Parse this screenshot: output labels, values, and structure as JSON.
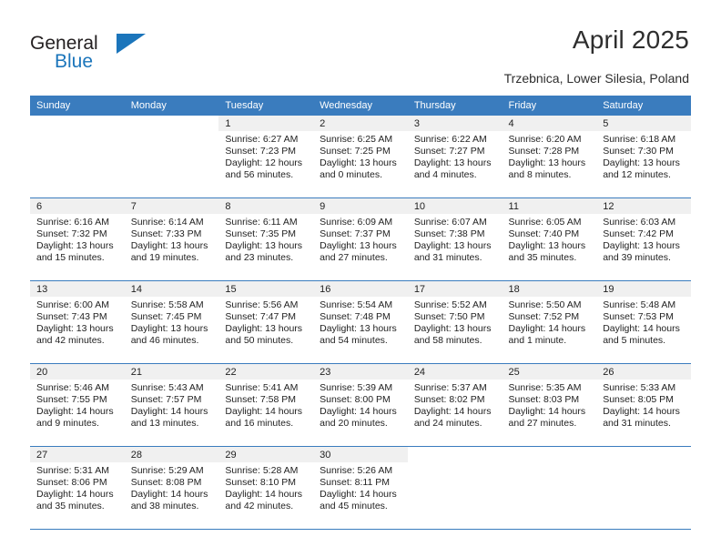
{
  "brand": {
    "name_part1": "General",
    "name_part2": "Blue",
    "logo_icon": "blue-triangle-icon"
  },
  "header": {
    "title": "April 2025",
    "subtitle": "Trzebnica, Lower Silesia, Poland"
  },
  "colors": {
    "header_blue": "#3a7cbe",
    "band_gray": "#f0f0f0",
    "brand_blue": "#1b75bb",
    "text": "#222222"
  },
  "calendar": {
    "weekday_headers": [
      "Sunday",
      "Monday",
      "Tuesday",
      "Wednesday",
      "Thursday",
      "Friday",
      "Saturday"
    ],
    "labels": {
      "sunrise": "Sunrise:",
      "sunset": "Sunset:",
      "daylight": "Daylight:"
    },
    "weeks": [
      [
        {
          "day": "",
          "sunrise": "",
          "sunset": "",
          "daylight": "",
          "blank": true
        },
        {
          "day": "",
          "sunrise": "",
          "sunset": "",
          "daylight": "",
          "blank": true
        },
        {
          "day": "1",
          "sunrise": "Sunrise: 6:27 AM",
          "sunset": "Sunset: 7:23 PM",
          "daylight": "Daylight: 12 hours and 56 minutes."
        },
        {
          "day": "2",
          "sunrise": "Sunrise: 6:25 AM",
          "sunset": "Sunset: 7:25 PM",
          "daylight": "Daylight: 13 hours and 0 minutes."
        },
        {
          "day": "3",
          "sunrise": "Sunrise: 6:22 AM",
          "sunset": "Sunset: 7:27 PM",
          "daylight": "Daylight: 13 hours and 4 minutes."
        },
        {
          "day": "4",
          "sunrise": "Sunrise: 6:20 AM",
          "sunset": "Sunset: 7:28 PM",
          "daylight": "Daylight: 13 hours and 8 minutes."
        },
        {
          "day": "5",
          "sunrise": "Sunrise: 6:18 AM",
          "sunset": "Sunset: 7:30 PM",
          "daylight": "Daylight: 13 hours and 12 minutes."
        }
      ],
      [
        {
          "day": "6",
          "sunrise": "Sunrise: 6:16 AM",
          "sunset": "Sunset: 7:32 PM",
          "daylight": "Daylight: 13 hours and 15 minutes."
        },
        {
          "day": "7",
          "sunrise": "Sunrise: 6:14 AM",
          "sunset": "Sunset: 7:33 PM",
          "daylight": "Daylight: 13 hours and 19 minutes."
        },
        {
          "day": "8",
          "sunrise": "Sunrise: 6:11 AM",
          "sunset": "Sunset: 7:35 PM",
          "daylight": "Daylight: 13 hours and 23 minutes."
        },
        {
          "day": "9",
          "sunrise": "Sunrise: 6:09 AM",
          "sunset": "Sunset: 7:37 PM",
          "daylight": "Daylight: 13 hours and 27 minutes."
        },
        {
          "day": "10",
          "sunrise": "Sunrise: 6:07 AM",
          "sunset": "Sunset: 7:38 PM",
          "daylight": "Daylight: 13 hours and 31 minutes."
        },
        {
          "day": "11",
          "sunrise": "Sunrise: 6:05 AM",
          "sunset": "Sunset: 7:40 PM",
          "daylight": "Daylight: 13 hours and 35 minutes."
        },
        {
          "day": "12",
          "sunrise": "Sunrise: 6:03 AM",
          "sunset": "Sunset: 7:42 PM",
          "daylight": "Daylight: 13 hours and 39 minutes."
        }
      ],
      [
        {
          "day": "13",
          "sunrise": "Sunrise: 6:00 AM",
          "sunset": "Sunset: 7:43 PM",
          "daylight": "Daylight: 13 hours and 42 minutes."
        },
        {
          "day": "14",
          "sunrise": "Sunrise: 5:58 AM",
          "sunset": "Sunset: 7:45 PM",
          "daylight": "Daylight: 13 hours and 46 minutes."
        },
        {
          "day": "15",
          "sunrise": "Sunrise: 5:56 AM",
          "sunset": "Sunset: 7:47 PM",
          "daylight": "Daylight: 13 hours and 50 minutes."
        },
        {
          "day": "16",
          "sunrise": "Sunrise: 5:54 AM",
          "sunset": "Sunset: 7:48 PM",
          "daylight": "Daylight: 13 hours and 54 minutes."
        },
        {
          "day": "17",
          "sunrise": "Sunrise: 5:52 AM",
          "sunset": "Sunset: 7:50 PM",
          "daylight": "Daylight: 13 hours and 58 minutes."
        },
        {
          "day": "18",
          "sunrise": "Sunrise: 5:50 AM",
          "sunset": "Sunset: 7:52 PM",
          "daylight": "Daylight: 14 hours and 1 minute."
        },
        {
          "day": "19",
          "sunrise": "Sunrise: 5:48 AM",
          "sunset": "Sunset: 7:53 PM",
          "daylight": "Daylight: 14 hours and 5 minutes."
        }
      ],
      [
        {
          "day": "20",
          "sunrise": "Sunrise: 5:46 AM",
          "sunset": "Sunset: 7:55 PM",
          "daylight": "Daylight: 14 hours and 9 minutes."
        },
        {
          "day": "21",
          "sunrise": "Sunrise: 5:43 AM",
          "sunset": "Sunset: 7:57 PM",
          "daylight": "Daylight: 14 hours and 13 minutes."
        },
        {
          "day": "22",
          "sunrise": "Sunrise: 5:41 AM",
          "sunset": "Sunset: 7:58 PM",
          "daylight": "Daylight: 14 hours and 16 minutes."
        },
        {
          "day": "23",
          "sunrise": "Sunrise: 5:39 AM",
          "sunset": "Sunset: 8:00 PM",
          "daylight": "Daylight: 14 hours and 20 minutes."
        },
        {
          "day": "24",
          "sunrise": "Sunrise: 5:37 AM",
          "sunset": "Sunset: 8:02 PM",
          "daylight": "Daylight: 14 hours and 24 minutes."
        },
        {
          "day": "25",
          "sunrise": "Sunrise: 5:35 AM",
          "sunset": "Sunset: 8:03 PM",
          "daylight": "Daylight: 14 hours and 27 minutes."
        },
        {
          "day": "26",
          "sunrise": "Sunrise: 5:33 AM",
          "sunset": "Sunset: 8:05 PM",
          "daylight": "Daylight: 14 hours and 31 minutes."
        }
      ],
      [
        {
          "day": "27",
          "sunrise": "Sunrise: 5:31 AM",
          "sunset": "Sunset: 8:06 PM",
          "daylight": "Daylight: 14 hours and 35 minutes."
        },
        {
          "day": "28",
          "sunrise": "Sunrise: 5:29 AM",
          "sunset": "Sunset: 8:08 PM",
          "daylight": "Daylight: 14 hours and 38 minutes."
        },
        {
          "day": "29",
          "sunrise": "Sunrise: 5:28 AM",
          "sunset": "Sunset: 8:10 PM",
          "daylight": "Daylight: 14 hours and 42 minutes."
        },
        {
          "day": "30",
          "sunrise": "Sunrise: 5:26 AM",
          "sunset": "Sunset: 8:11 PM",
          "daylight": "Daylight: 14 hours and 45 minutes."
        },
        {
          "day": "",
          "sunrise": "",
          "sunset": "",
          "daylight": "",
          "blank": true
        },
        {
          "day": "",
          "sunrise": "",
          "sunset": "",
          "daylight": "",
          "blank": true
        },
        {
          "day": "",
          "sunrise": "",
          "sunset": "",
          "daylight": "",
          "blank": true
        }
      ]
    ]
  }
}
